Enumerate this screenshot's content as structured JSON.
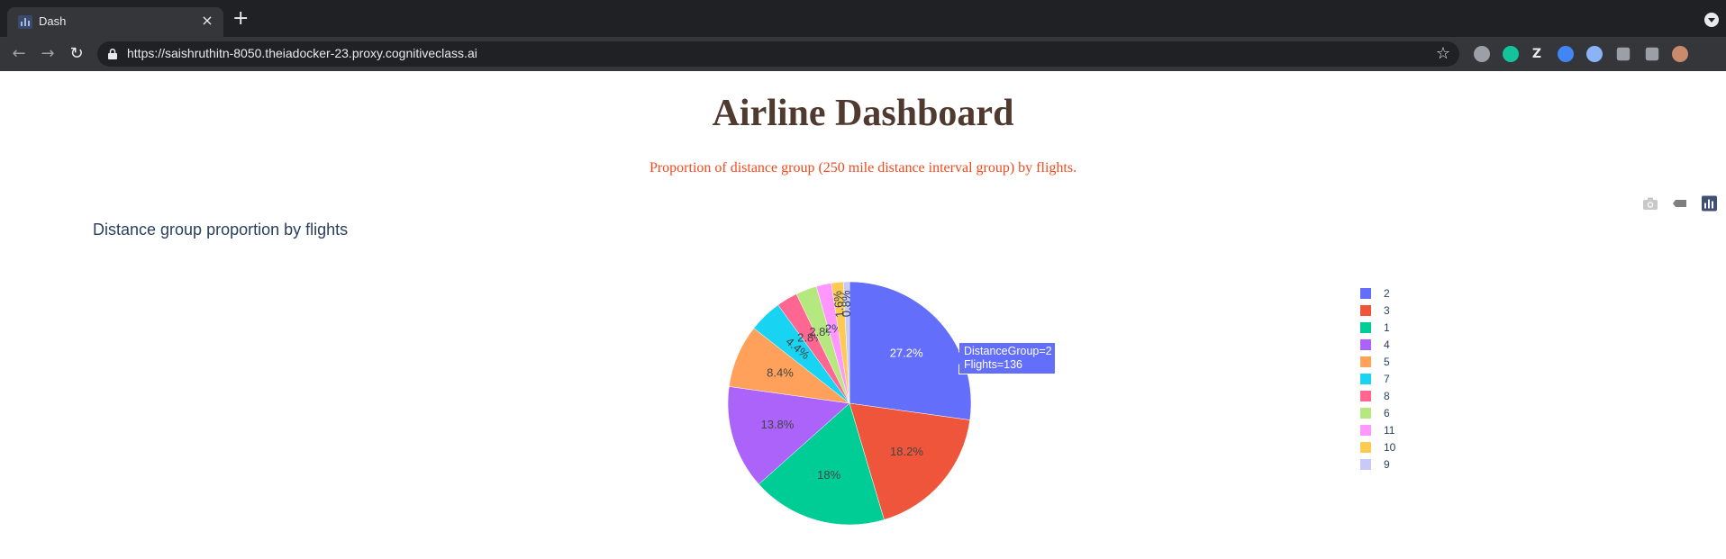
{
  "browser": {
    "tab_title": "Dash",
    "tab_close": "×",
    "new_tab": "+",
    "url": "https://saishruthitn-8050.theiadocker-23.proxy.cognitiveclass.ai",
    "back": "←",
    "forward": "→",
    "reload": "↻",
    "star": "☆",
    "extensions": [
      {
        "name": "extension-record-icon",
        "color": "#9aa0a6"
      },
      {
        "name": "grammarly-icon",
        "color": "#15c39a"
      },
      {
        "name": "zotero-icon",
        "color": "#35363a"
      },
      {
        "name": "extension-blue-icon",
        "color": "#4285f4"
      },
      {
        "name": "extension-circle-icon",
        "color": "#8ab4f8"
      },
      {
        "name": "puzzle-icon",
        "color": "#9aa0a6"
      },
      {
        "name": "media-control-icon",
        "color": "#9aa0a6"
      },
      {
        "name": "profile-avatar",
        "color": "#c98b6b"
      }
    ]
  },
  "page": {
    "title": "Airline Dashboard",
    "subtitle": "Proportion of distance group (250 mile distance interval group) by flights.",
    "title_color": "#503A2F",
    "subtitle_color": "#F24A1F"
  },
  "modebar": [
    "camera-icon",
    "tag-icon",
    "plotly-logo-icon"
  ],
  "chart_data": {
    "type": "pie",
    "title": "Distance group proportion by flights",
    "slices": [
      {
        "label": "2",
        "percent": 27.2,
        "text": "27.2%",
        "color": "#636efa",
        "text_color": "#ffffff"
      },
      {
        "label": "3",
        "percent": 18.2,
        "text": "18.2%",
        "color": "#EF553B",
        "text_color": "#444444"
      },
      {
        "label": "1",
        "percent": 18.0,
        "text": "18%",
        "color": "#00cc96",
        "text_color": "#444444"
      },
      {
        "label": "4",
        "percent": 13.8,
        "text": "13.8%",
        "color": "#ab63fa",
        "text_color": "#444444"
      },
      {
        "label": "5",
        "percent": 8.4,
        "text": "8.4%",
        "color": "#FFA15A",
        "text_color": "#444444"
      },
      {
        "label": "7",
        "percent": 4.4,
        "text": "4.4%",
        "color": "#19d3f3",
        "text_color": "#444444"
      },
      {
        "label": "8",
        "percent": 2.8,
        "text": "2.8%",
        "color": "#FF6692",
        "text_color": "#444444"
      },
      {
        "label": "6",
        "percent": 2.8,
        "text": "2.8%",
        "color": "#B6E880",
        "text_color": "#444444"
      },
      {
        "label": "11",
        "percent": 2.0,
        "text": "2%",
        "color": "#FF97FF",
        "text_color": "#2a3f5f"
      },
      {
        "label": "10",
        "percent": 1.6,
        "text": "1.6%",
        "color": "#FECB52",
        "text_color": "#2a3f5f"
      },
      {
        "label": "9",
        "percent": 0.8,
        "text": "0.8%",
        "color": "#c9c9f7",
        "text_color": "#2a3f5f"
      }
    ],
    "legend_position": "right",
    "tooltip": {
      "line1": "DistanceGroup=2",
      "line2": "Flights=136"
    }
  }
}
